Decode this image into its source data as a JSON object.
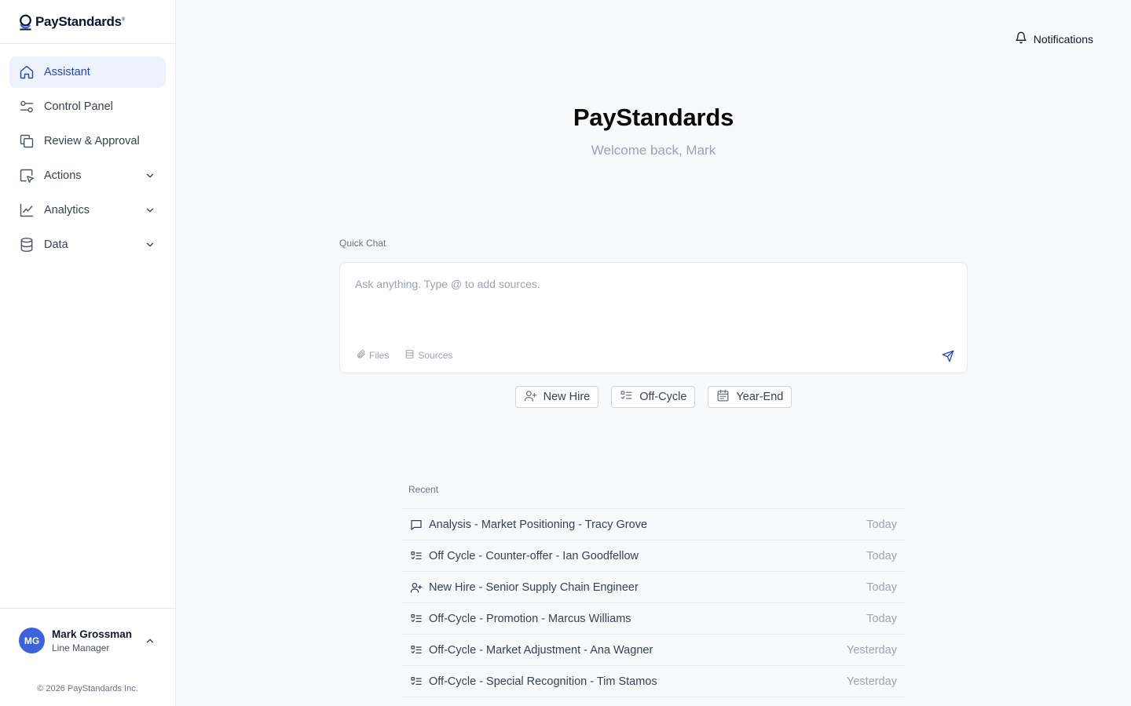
{
  "brand": {
    "name": "PayStandards",
    "mark": "®"
  },
  "sidebar": {
    "items": [
      {
        "label": "Assistant",
        "icon": "home-icon",
        "active": true
      },
      {
        "label": "Control Panel",
        "icon": "sliders-icon"
      },
      {
        "label": "Review & Approval",
        "icon": "copy-icon"
      },
      {
        "label": "Actions",
        "icon": "cursor-click-icon",
        "expandable": true
      },
      {
        "label": "Analytics",
        "icon": "line-chart-icon",
        "expandable": true
      },
      {
        "label": "Data",
        "icon": "database-icon",
        "expandable": true
      }
    ]
  },
  "user": {
    "initials": "MG",
    "name": "Mark Grossman",
    "role": "Line Manager"
  },
  "footer": {
    "copyright": "© 2026 PayStandards Inc."
  },
  "header": {
    "notifications_label": "Notifications"
  },
  "hero": {
    "title": "PayStandards",
    "subtitle": "Welcome back, Mark"
  },
  "quick_chat": {
    "label": "Quick Chat",
    "placeholder": "Ask anything. Type @ to add sources.",
    "files_label": "Files",
    "sources_label": "Sources"
  },
  "chips": [
    {
      "label": "New Hire",
      "icon": "user-plus-icon"
    },
    {
      "label": "Off-Cycle",
      "icon": "checklist-icon"
    },
    {
      "label": "Year-End",
      "icon": "calendar-icon"
    }
  ],
  "recent": {
    "label": "Recent",
    "items": [
      {
        "title": "Analysis - Market Positioning - Tracy Grove",
        "date": "Today",
        "icon": "message-icon"
      },
      {
        "title": "Off Cycle - Counter-offer - Ian Goodfellow",
        "date": "Today",
        "icon": "checklist-icon"
      },
      {
        "title": "New Hire - Senior Supply Chain Engineer",
        "date": "Today",
        "icon": "user-plus-icon"
      },
      {
        "title": "Off-Cycle - Promotion - Marcus Williams",
        "date": "Today",
        "icon": "checklist-icon"
      },
      {
        "title": "Off-Cycle - Market Adjustment - Ana Wagner",
        "date": "Yesterday",
        "icon": "checklist-icon"
      },
      {
        "title": "Off-Cycle - Special Recognition - Tim Stamos",
        "date": "Yesterday",
        "icon": "checklist-icon"
      }
    ]
  },
  "colors": {
    "accent": "#2446b5",
    "active_bg": "#edf2fc",
    "avatar": "#3b63e0"
  }
}
